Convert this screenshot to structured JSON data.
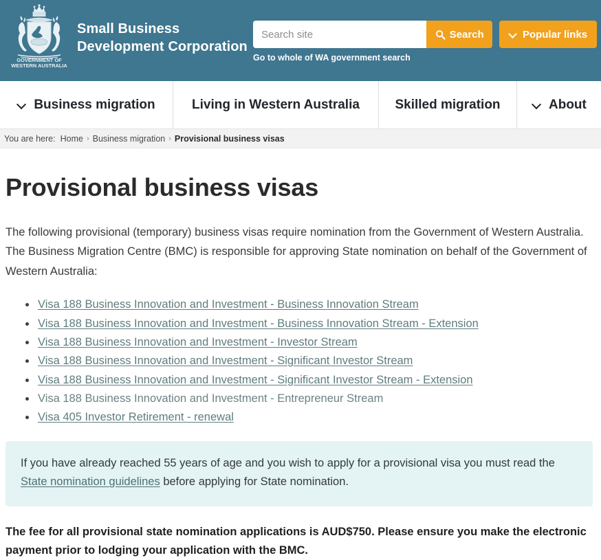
{
  "header": {
    "crest_caption_line1": "GOVERNMENT OF",
    "crest_caption_line2": "WESTERN AUSTRALIA",
    "org_line1": "Small Business",
    "org_line2": "Development Corporation",
    "background_color": "#3f7690",
    "accent_color": "#f2a11c"
  },
  "search": {
    "placeholder": "Search site",
    "value": "",
    "search_label": "Search",
    "popular_links_label": "Popular links",
    "wa_gov_search_label": "Go to whole of WA government search"
  },
  "nav": {
    "items": [
      {
        "label": "Business migration",
        "has_dropdown": true
      },
      {
        "label": "Living in Western Australia",
        "has_dropdown": false
      },
      {
        "label": "Skilled migration",
        "has_dropdown": false
      },
      {
        "label": "About",
        "has_dropdown": true
      }
    ]
  },
  "breadcrumb": {
    "label": "You are here:",
    "separator": "›",
    "items": [
      {
        "label": "Home",
        "current": false
      },
      {
        "label": "Business migration",
        "current": false
      },
      {
        "label": "Provisional business visas",
        "current": true
      }
    ]
  },
  "main": {
    "title": "Provisional business visas",
    "intro": "The following provisional (temporary) business visas require nomination from the Government of Western Australia. The Business Migration Centre (BMC) is responsible for approving State nomination on behalf of the Government of Western Australia:",
    "visa_list": [
      {
        "label": "Visa 188 Business Innovation and Investment - Business Innovation Stream",
        "is_link": true
      },
      {
        "label": "Visa 188 Business Innovation and Investment - Business Innovation Stream - Extension",
        "is_link": true
      },
      {
        "label": "Visa 188 Business Innovation and Investment - Investor Stream",
        "is_link": true
      },
      {
        "label": "Visa 188 Business Innovation and Investment - Significant Investor Stream",
        "is_link": true
      },
      {
        "label": "Visa 188 Business Innovation and Investment - Significant Investor Stream - Extension",
        "is_link": true
      },
      {
        "label": "Visa 188 Business Innovation and Investment - Entrepreneur Stream",
        "is_link": false
      },
      {
        "label": "Visa 405 Investor Retirement - renewal",
        "is_link": true
      }
    ],
    "callout": {
      "text_before_link": "If you have already reached 55 years of age and you wish to apply for a provisional visa you must read the ",
      "link_label": "State nomination guidelines",
      "text_after_link": " before applying for State nomination.",
      "background_color": "#e4f3f4"
    },
    "fee_note": "The fee for all provisional state nomination applications is AUD$750. Please ensure you make the electronic payment prior to lodging your application with the BMC."
  },
  "icons": {
    "search": "search-icon",
    "chevron_down": "chevron-down-icon",
    "crest": "wa-coat-of-arms-icon"
  }
}
